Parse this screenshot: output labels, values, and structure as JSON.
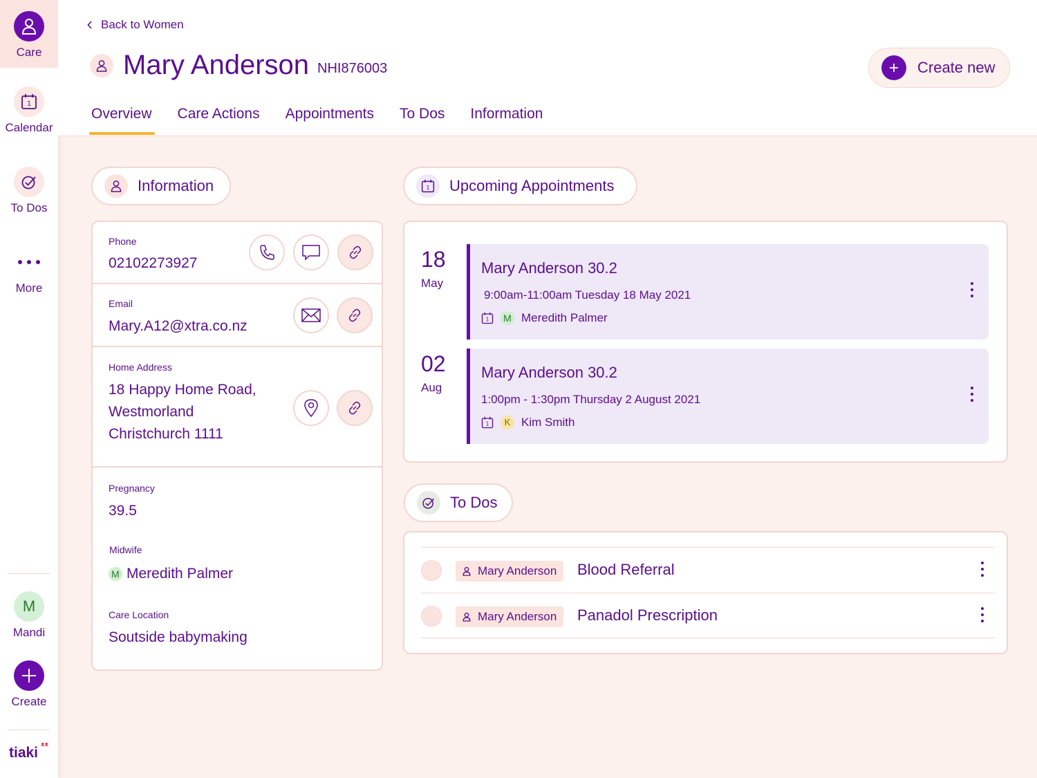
{
  "sidebar": {
    "care_label": "Care",
    "calendar_label": "Calendar",
    "todos_label": "To Dos",
    "more_label": "More",
    "user_initial": "M",
    "user_label": "Mandi",
    "create_label": "Create",
    "logo_text": "tiaki"
  },
  "header": {
    "back_label": "Back to Women",
    "patient_name": "Mary Anderson",
    "nhi": "NHI876003",
    "create_new_label": "Create new",
    "tabs": [
      {
        "label": "Overview"
      },
      {
        "label": "Care Actions"
      },
      {
        "label": "Appointments"
      },
      {
        "label": "To Dos"
      },
      {
        "label": "Information"
      }
    ],
    "active_tab": "Overview"
  },
  "information": {
    "section_title": "Information",
    "phone_label": "Phone",
    "phone_value": "02102273927",
    "email_label": "Email",
    "email_value": "Mary.A12@xtra.co.nz",
    "address_label": "Home Address",
    "address_lines": [
      "18 Happy Home Road,",
      "Westmorland",
      "Christchurch 1111"
    ],
    "pregnancy_label": "Pregnancy",
    "pregnancy_value": "39.5",
    "midwife_label": "Midwife",
    "midwife_initial": "M",
    "midwife_value": "Meredith Palmer",
    "care_location_label": "Care Location",
    "care_location_value": "Soutside babymaking"
  },
  "appointments": {
    "section_title": "Upcoming Appointments",
    "items": [
      {
        "day": "18",
        "month": "May",
        "title": "Mary Anderson 30.2",
        "time": "9:00am-11:00am Tuesday 18 May 2021",
        "who_initial": "M",
        "who": "Meredith Palmer"
      },
      {
        "day": "02",
        "month": "Aug",
        "title": "Mary Anderson 30.2",
        "time": "1:00pm - 1:30pm Thursday 2 August 2021",
        "who_initial": "K",
        "who": "Kim Smith"
      }
    ]
  },
  "todos": {
    "section_title": "To Dos",
    "items": [
      {
        "person": "Mary Anderson",
        "task": "Blood Referral"
      },
      {
        "person": "Mary Anderson",
        "task": "Panadol Prescription"
      }
    ]
  },
  "colors": {
    "primary": "#6a0dad",
    "text": "#5a0f8c",
    "background": "#fdf1ee",
    "accent_tab": "#f5b32e"
  }
}
